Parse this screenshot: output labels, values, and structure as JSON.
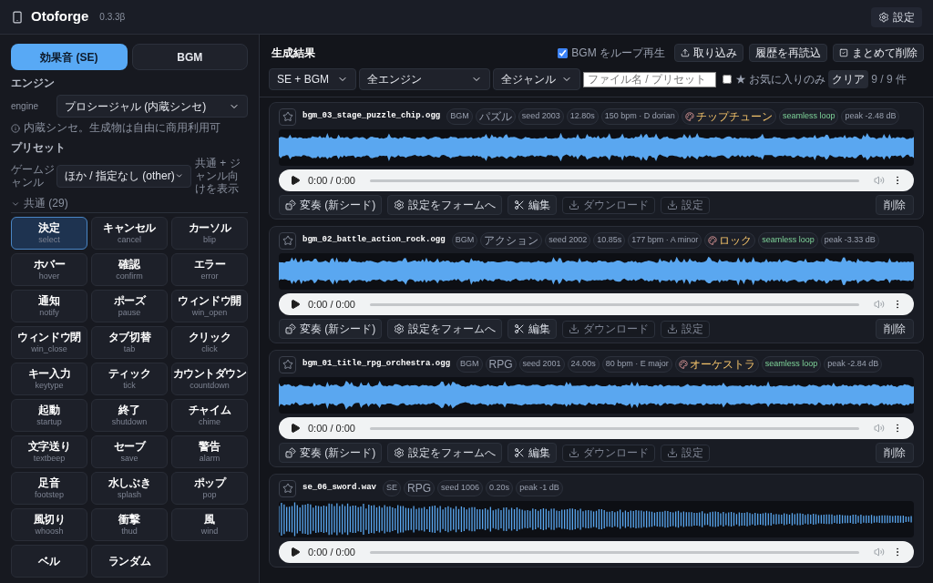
{
  "header": {
    "app_name": "Otoforge",
    "version": "0.3.3β",
    "settings_button": "設定"
  },
  "sidebar": {
    "mode_tabs": [
      {
        "label": "効果音 (SE)",
        "selected": true
      },
      {
        "label": "BGM",
        "selected": false
      }
    ],
    "engine": {
      "heading": "エンジン",
      "label": "engine",
      "value": "プロシージャル (内蔵シンセ)",
      "note": "内蔵シンセ。生成物は自由に商用利用可"
    },
    "preset": {
      "heading": "プリセット",
      "genre_label": "ゲームジャンル",
      "genre_value": "ほか / 指定なし (other)",
      "genre_hint": "共通 + ジャンル向けを表示"
    },
    "group": {
      "label": "共通 (29)",
      "expanded": true
    },
    "presets": [
      {
        "label": "決定",
        "sub": "select",
        "selected": true
      },
      {
        "label": "キャンセル",
        "sub": "cancel",
        "selected": false
      },
      {
        "label": "カーソル",
        "sub": "blip",
        "selected": false
      },
      {
        "label": "ホバー",
        "sub": "hover",
        "selected": false
      },
      {
        "label": "確認",
        "sub": "confirm",
        "selected": false
      },
      {
        "label": "エラー",
        "sub": "error",
        "selected": false
      },
      {
        "label": "通知",
        "sub": "notify",
        "selected": false
      },
      {
        "label": "ポーズ",
        "sub": "pause",
        "selected": false
      },
      {
        "label": "ウィンドウ開",
        "sub": "win_open",
        "selected": false
      },
      {
        "label": "ウィンドウ閉",
        "sub": "win_close",
        "selected": false
      },
      {
        "label": "タブ切替",
        "sub": "tab",
        "selected": false
      },
      {
        "label": "クリック",
        "sub": "click",
        "selected": false
      },
      {
        "label": "キー入力",
        "sub": "keytype",
        "selected": false
      },
      {
        "label": "ティック",
        "sub": "tick",
        "selected": false
      },
      {
        "label": "カウントダウン",
        "sub": "countdown",
        "selected": false
      },
      {
        "label": "起動",
        "sub": "startup",
        "selected": false
      },
      {
        "label": "終了",
        "sub": "shutdown",
        "selected": false
      },
      {
        "label": "チャイム",
        "sub": "chime",
        "selected": false
      },
      {
        "label": "文字送り",
        "sub": "textbeep",
        "selected": false
      },
      {
        "label": "セーブ",
        "sub": "save",
        "selected": false
      },
      {
        "label": "警告",
        "sub": "alarm",
        "selected": false
      },
      {
        "label": "足音",
        "sub": "footstep",
        "selected": false
      },
      {
        "label": "水しぶき",
        "sub": "splash",
        "selected": false
      },
      {
        "label": "ポップ",
        "sub": "pop",
        "selected": false
      },
      {
        "label": "風切り",
        "sub": "whoosh",
        "selected": false
      },
      {
        "label": "衝撃",
        "sub": "thud",
        "selected": false
      },
      {
        "label": "風",
        "sub": "wind",
        "selected": false
      },
      {
        "label": "ベル",
        "selected": false
      },
      {
        "label": "ランダム",
        "selected": false
      }
    ]
  },
  "main": {
    "title": "生成結果",
    "loop_checkbox": {
      "label": "BGM をループ再生",
      "checked": true
    },
    "toolbar_buttons": [
      "取り込み",
      "履歴を再読込",
      "まとめて削除"
    ],
    "filters": [
      "SE + BGM",
      "全エンジン",
      "全ジャンル"
    ],
    "search": {
      "placeholder": "ファイル名 / プリセット"
    },
    "favorites_only": {
      "label": "★ お気に入りのみ",
      "checked": false
    },
    "clear_button": "クリア",
    "count": "9 / 9 件",
    "results": [
      {
        "kind": "bgm",
        "filename": "bgm_03_stage_puzzle_chip.ogg",
        "favorite": false,
        "tags": [
          {
            "text": "BGM",
            "kind": "plain"
          },
          {
            "text": "パズル",
            "kind": "genre"
          },
          {
            "text": "seed 2003",
            "kind": "plain"
          },
          {
            "text": "12.80s",
            "kind": "plain"
          },
          {
            "text": "150 bpm · D dorian",
            "kind": "plain"
          },
          {
            "text": "チップチューン",
            "kind": "style"
          },
          {
            "text": "seamless loop",
            "kind": "loop"
          },
          {
            "text": "peak -2.48 dB",
            "kind": "plain"
          }
        ],
        "time": "0:00 / 0:00",
        "actions": [
          {
            "label": "変奏 (新シード)",
            "disabled": false
          },
          {
            "label": "設定をフォームへ",
            "disabled": false
          },
          {
            "label": "編集",
            "disabled": false
          },
          {
            "label": "ダウンロード",
            "disabled": true
          },
          {
            "label": "設定",
            "disabled": true
          }
        ],
        "delete": "削除"
      },
      {
        "kind": "bgm",
        "filename": "bgm_02_battle_action_rock.ogg",
        "favorite": false,
        "tags": [
          {
            "text": "BGM",
            "kind": "plain"
          },
          {
            "text": "アクション",
            "kind": "genre"
          },
          {
            "text": "seed 2002",
            "kind": "plain"
          },
          {
            "text": "10.85s",
            "kind": "plain"
          },
          {
            "text": "177 bpm · A minor",
            "kind": "plain"
          },
          {
            "text": "ロック",
            "kind": "style"
          },
          {
            "text": "seamless loop",
            "kind": "loop"
          },
          {
            "text": "peak -3.33 dB",
            "kind": "plain"
          }
        ],
        "time": "0:00 / 0:00",
        "actions": [
          {
            "label": "変奏 (新シード)",
            "disabled": false
          },
          {
            "label": "設定をフォームへ",
            "disabled": false
          },
          {
            "label": "編集",
            "disabled": false
          },
          {
            "label": "ダウンロード",
            "disabled": true
          },
          {
            "label": "設定",
            "disabled": true
          }
        ],
        "delete": "削除"
      },
      {
        "kind": "bgm",
        "filename": "bgm_01_title_rpg_orchestra.ogg",
        "favorite": false,
        "tags": [
          {
            "text": "BGM",
            "kind": "plain"
          },
          {
            "text": "RPG",
            "kind": "genre"
          },
          {
            "text": "seed 2001",
            "kind": "plain"
          },
          {
            "text": "24.00s",
            "kind": "plain"
          },
          {
            "text": "80 bpm · E major",
            "kind": "plain"
          },
          {
            "text": "オーケストラ",
            "kind": "style"
          },
          {
            "text": "seamless loop",
            "kind": "loop"
          },
          {
            "text": "peak -2.84 dB",
            "kind": "plain"
          }
        ],
        "time": "0:00 / 0:00",
        "actions": [
          {
            "label": "変奏 (新シード)",
            "disabled": false
          },
          {
            "label": "設定をフォームへ",
            "disabled": false
          },
          {
            "label": "編集",
            "disabled": false
          },
          {
            "label": "ダウンロード",
            "disabled": true
          },
          {
            "label": "設定",
            "disabled": true
          }
        ],
        "delete": "削除"
      },
      {
        "kind": "se",
        "filename": "se_06_sword.wav",
        "favorite": false,
        "tags": [
          {
            "text": "SE",
            "kind": "plain"
          },
          {
            "text": "RPG",
            "kind": "genre"
          },
          {
            "text": "seed 1006",
            "kind": "plain"
          },
          {
            "text": "0.20s",
            "kind": "plain"
          },
          {
            "text": "peak -1 dB",
            "kind": "plain"
          }
        ],
        "time": "0:00 / 0:00"
      }
    ]
  }
}
